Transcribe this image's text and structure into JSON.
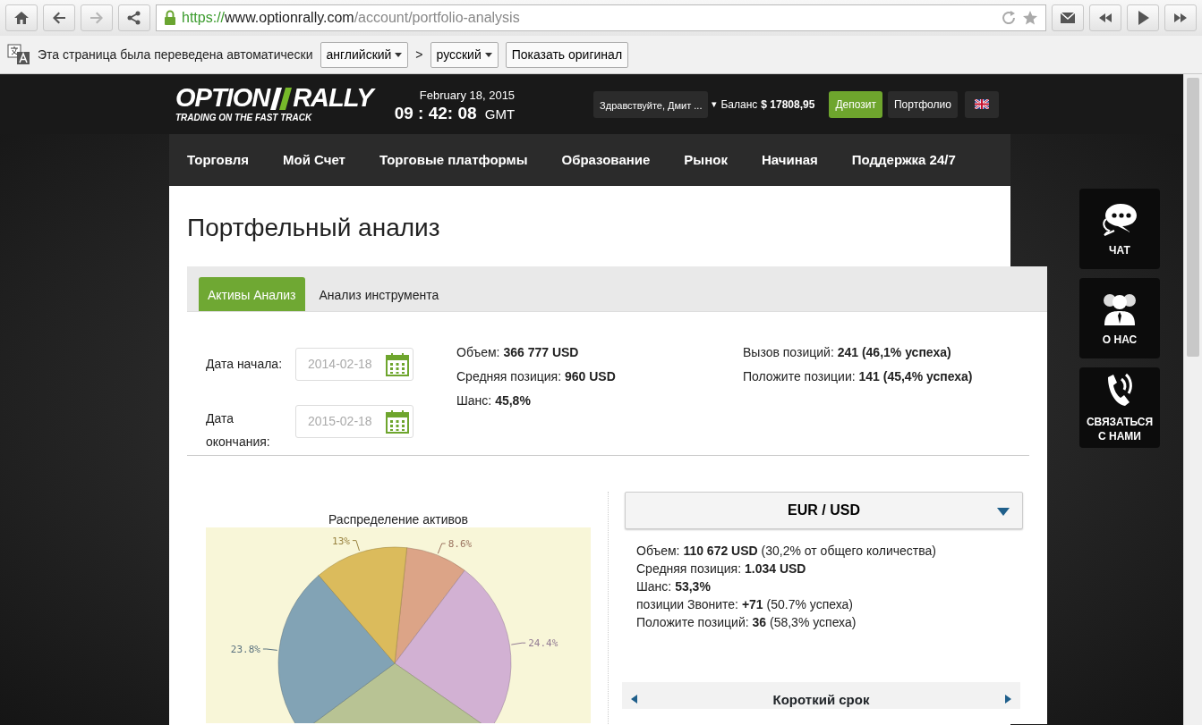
{
  "browser": {
    "url": {
      "scheme": "https://",
      "host": "www.optionrally.com",
      "path": "/account/portfolio-analysis"
    },
    "back_disabled": false,
    "forward_disabled": true
  },
  "translate_bar": {
    "message": "Эта страница была переведена автоматически",
    "from_language": "английский",
    "separator": ">",
    "to_language": "русский",
    "show_original_button": "Показать оригинал"
  },
  "header": {
    "logo": {
      "left": "OPTION",
      "right": "RALLY",
      "tagline": "TRADING ON THE FAST TRACK"
    },
    "date": "February 18, 2015",
    "time": "09 : 42: 08",
    "timezone": "GMT",
    "greeting": "Здравствуйте, Дмит ...",
    "caret": "▾",
    "balance_label": "Баланс",
    "balance_value": "$ 17808,95",
    "buttons": [
      {
        "label": "Депозит",
        "kind": "primary"
      },
      {
        "label": "Портфолио",
        "kind": "dark"
      }
    ]
  },
  "nav": [
    "Торговля",
    "Мой Счет",
    "Торговые платформы",
    "Образование",
    "Рынок",
    "Начиная",
    "Поддержка 24/7"
  ],
  "page_title": "Портфельный анализ",
  "tabs": [
    {
      "label": "Активы Анализ",
      "selected": true
    },
    {
      "label": "Анализ инструмента",
      "selected": false
    }
  ],
  "date_fields": [
    {
      "label": "Дата начала:",
      "value": "2014-02-18"
    },
    {
      "label": "Дата окончания:",
      "value": "2015-02-18"
    }
  ],
  "summary": {
    "column_1": [
      "Объем: **366 777 USD**",
      "Средняя позиция: **960 USD**",
      "Шанс: **45,8%**"
    ],
    "column_2": [
      "Вызов позиций: **241 (46,1% успеха)**",
      "Положите позиции: **141 (45,4% успеха)**"
    ]
  },
  "chart": {
    "chart_data": {
      "type": "pie",
      "title": "Распределение активов",
      "series": [
        {
          "values": [
            8.6,
            24.4,
            30.2,
            23.8,
            13
          ],
          "colors": [
            "#dca487",
            "#d2b1d3",
            "#b8c394",
            "#82a3b5",
            "#dbbb5c"
          ]
        }
      ],
      "value_labels": [
        "8.6%",
        "24.4%",
        null,
        "23.8%",
        "13%"
      ]
    }
  },
  "instrument": {
    "selector": "EUR / USD",
    "stats": [
      "Объем: **110 672 USD** (30,2% от общего количества)",
      "Средняя позиция: **1.034 USD**",
      "Шанс: **53,3%**",
      "позиции Звоните: **+71** (50.7% успеха)",
      "Положите позиций: **36** (58,3% успеха)"
    ],
    "term_title": "Короткий срок"
  },
  "side_buttons": [
    {
      "label": "ЧАТ",
      "kind": "chat"
    },
    {
      "label": "О НАС",
      "kind": "people"
    },
    {
      "label": "СВЯЗАТЬСЯ С НАМИ",
      "kind": "phone"
    }
  ]
}
